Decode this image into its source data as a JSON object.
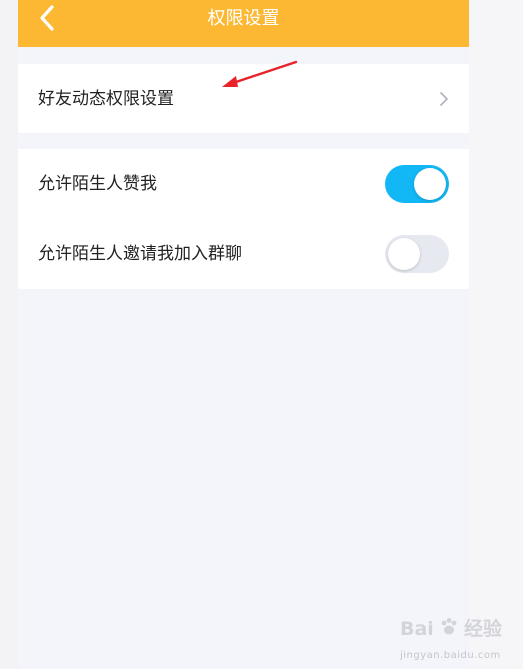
{
  "header": {
    "title": "权限设置",
    "back_icon": "back-chevron-icon",
    "color": "#fdb833"
  },
  "sections": [
    {
      "rows": [
        {
          "label": "好友动态权限设置",
          "type": "link",
          "icon": "chevron-right-icon"
        }
      ]
    },
    {
      "rows": [
        {
          "label": "允许陌生人赞我",
          "type": "toggle",
          "state": "on"
        },
        {
          "label": "允许陌生人邀请我加入群聊",
          "type": "toggle",
          "state": "off"
        }
      ]
    }
  ],
  "annotation": {
    "arrow_color": "#e8222a",
    "target": "好友动态权限设置"
  },
  "colors": {
    "toggle_on": "#12b7f5",
    "toggle_off": "#e7e9f0",
    "page_bg": "#f4f5fa"
  },
  "watermark": {
    "logo_text_left": "Bai",
    "logo_text_right": "经验",
    "url": "jingyan.baidu.com"
  }
}
